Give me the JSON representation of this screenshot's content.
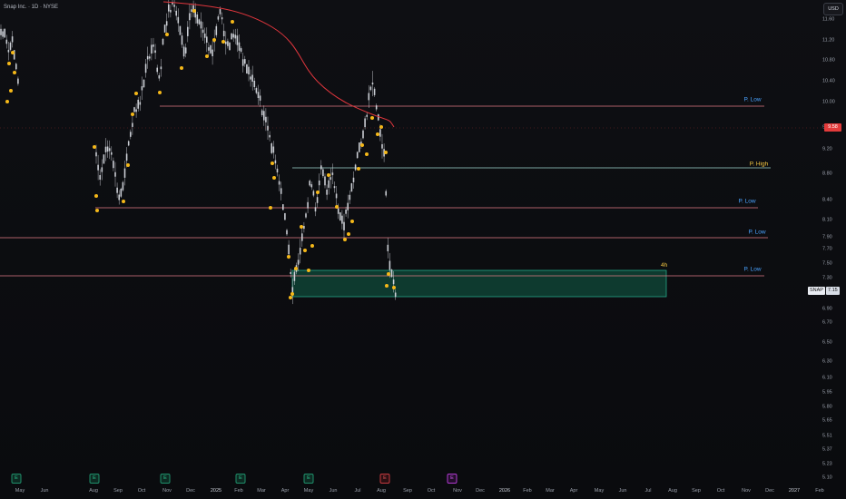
{
  "header": {
    "title": "Snap Inc. · 1D · NYSE"
  },
  "currency_button": "USD",
  "colors": {
    "ma": "#e0363d",
    "level": "#e07a85",
    "high_line": "#9fd8d0",
    "zone_fill": "#0f4a3a",
    "zone_border": "#26a888",
    "dots": "#f5b819",
    "candles": "#d8dbe2",
    "price_tag": "#e23b3b"
  },
  "price_axis": [
    "11.60",
    "11.20",
    "10.80",
    "10.40",
    "10.00",
    "9.58",
    "9.20",
    "8.80",
    "8.40",
    "8.10",
    "7.90",
    "7.70",
    "7.50",
    "7.30",
    "6.90",
    "6.70",
    "6.50",
    "6.30",
    "6.10",
    "5.95",
    "5.80",
    "5.65",
    "5.51",
    "5.37",
    "5.23",
    "5.10"
  ],
  "time_axis": [
    {
      "label": "May",
      "year": false
    },
    {
      "label": "Jun",
      "year": false
    },
    {
      "label": "Aug",
      "year": false
    },
    {
      "label": "Sep",
      "year": false
    },
    {
      "label": "Oct",
      "year": false
    },
    {
      "label": "Nov",
      "year": false
    },
    {
      "label": "Dec",
      "year": false
    },
    {
      "label": "2025",
      "year": true
    },
    {
      "label": "Feb",
      "year": false
    },
    {
      "label": "Mar",
      "year": false
    },
    {
      "label": "Apr",
      "year": false
    },
    {
      "label": "May",
      "year": false
    },
    {
      "label": "Jun",
      "year": false
    },
    {
      "label": "Jul",
      "year": false
    },
    {
      "label": "Aug",
      "year": false
    },
    {
      "label": "Sep",
      "year": false
    },
    {
      "label": "Oct",
      "year": false
    },
    {
      "label": "Nov",
      "year": false
    },
    {
      "label": "Dec",
      "year": false
    },
    {
      "label": "2026",
      "year": true
    },
    {
      "label": "Feb",
      "year": false
    },
    {
      "label": "Mar",
      "year": false
    },
    {
      "label": "Apr",
      "year": false
    },
    {
      "label": "May",
      "year": false
    },
    {
      "label": "Jun",
      "year": false
    },
    {
      "label": "Jul",
      "year": false
    },
    {
      "label": "Aug",
      "year": false
    },
    {
      "label": "Sep",
      "year": false
    },
    {
      "label": "Oct",
      "year": false
    },
    {
      "label": "Nov",
      "year": false
    },
    {
      "label": "Dec",
      "year": false
    },
    {
      "label": "2027",
      "year": true
    },
    {
      "label": "Feb",
      "year": false
    }
  ],
  "levels": [
    {
      "label": "P. Low",
      "kind": "low"
    },
    {
      "label": "P. High",
      "kind": "high"
    },
    {
      "label": "P. Low",
      "kind": "low"
    },
    {
      "label": "P. Low",
      "kind": "low"
    },
    {
      "label": "P. Low",
      "kind": "low"
    }
  ],
  "current_price": "9.58",
  "symbol_tag": {
    "symbol": "SNAP",
    "price": "7.15"
  },
  "zone_label": "4h",
  "events": [
    {
      "glyph": "E",
      "kind": "earn"
    },
    {
      "glyph": "E",
      "kind": "earn"
    },
    {
      "glyph": "E",
      "kind": "earn"
    },
    {
      "glyph": "E",
      "kind": "earn"
    },
    {
      "glyph": "E",
      "kind": "earn"
    },
    {
      "glyph": "E",
      "kind": "earn-neg"
    },
    {
      "glyph": "E",
      "kind": "div"
    }
  ]
}
